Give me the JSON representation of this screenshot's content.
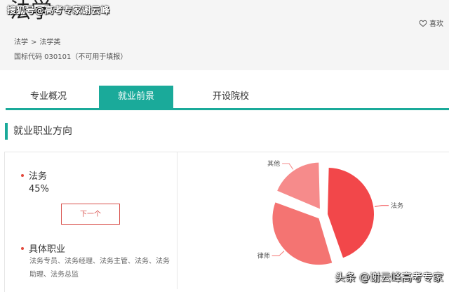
{
  "header": {
    "title": "法学",
    "breadcrumb": [
      "法学",
      "法学类"
    ],
    "breadcrumb_sep": ">",
    "code_text": "国标代码 030101（不可用于填报）",
    "favorite_label": "喜欢"
  },
  "watermarks": {
    "top": "搜狐号@高考专家谢云峰",
    "bottom": "头条 @谢云峰高考专家"
  },
  "tabs": [
    {
      "label": "专业概况",
      "active": false
    },
    {
      "label": "就业前景",
      "active": true
    },
    {
      "label": "开设院校",
      "active": false
    }
  ],
  "section": {
    "title": "就业职业方向"
  },
  "detail": {
    "item_name": "法务",
    "item_percent": "45%",
    "next_label": "下一个",
    "jobs_heading": "具体职业",
    "jobs_text": "法务专员、法务经理、法务主管、法务、法务助理、法务总监"
  },
  "colors": {
    "accent": "#1aaa9a",
    "button_red": "#d9534f",
    "slice_main": "#f2474a",
    "slice_2": "#f47472",
    "slice_3": "#f68b8b"
  },
  "chart_data": {
    "type": "pie",
    "slices": [
      {
        "label": "法务",
        "value": 45,
        "exploded": false
      },
      {
        "label": "律师",
        "value": 36,
        "exploded": true
      },
      {
        "label": "其他",
        "value": 19,
        "exploded": true
      }
    ]
  }
}
